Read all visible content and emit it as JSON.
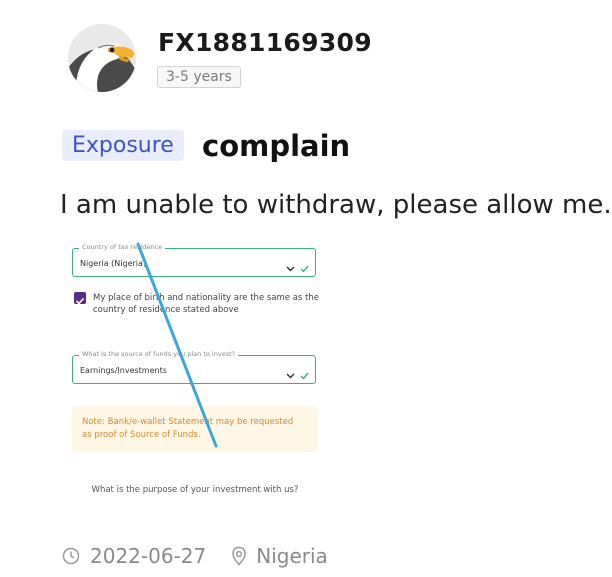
{
  "user": {
    "name": "FX1881169309",
    "experience": "3-5 years",
    "avatar_icon": "eagle-avatar-icon"
  },
  "post": {
    "category": "Exposure",
    "type": "complain",
    "text": "I am unable to withdraw, please allow me."
  },
  "attachment": {
    "country_field": {
      "label": "Country of tax residence",
      "value": "Nigeria (Nigeria)"
    },
    "checkbox_text": "My place of birth and nationality are the same as the country of residence stated above",
    "funds_field": {
      "label": "What is the source of funds you plan to invest?",
      "value": "Earnings/Investments"
    },
    "note": "Note: Bank/e-wallet Statement may be requested as proof of Source of Funds.",
    "question": "What is the purpose of your investment with us?",
    "accent_color": "#3ab07a",
    "checkbox_color": "#5a2d82",
    "annotation_color": "#3aa7d8"
  },
  "footer": {
    "date": "2022-06-27",
    "location": "Nigeria"
  }
}
